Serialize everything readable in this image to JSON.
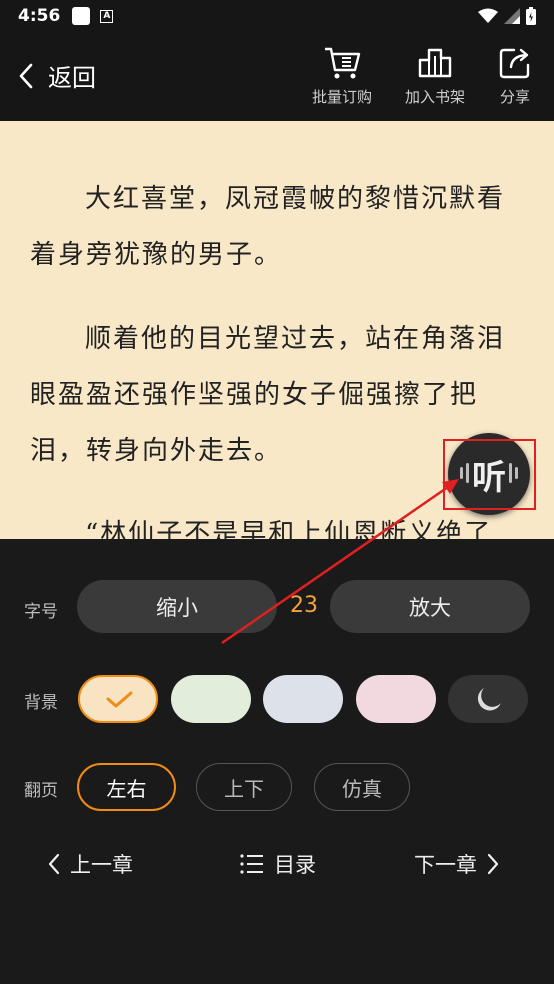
{
  "status": {
    "time": "4:56",
    "a_badge": "A"
  },
  "topbar": {
    "back_label": "返回",
    "batch_label": "批量订购",
    "shelf_label": "加入书架",
    "share_label": "分享"
  },
  "reading": {
    "paragraphs": [
      "大红喜堂，凤冠霞帔的黎惜沉默看着身旁犹豫的男子。",
      "顺着他的目光望过去，站在角落泪眼盈盈还强作坚强的女子倔强擦了把泪，转身向外走去。",
      "“林仙子不是早和上仙恩断义绝了"
    ]
  },
  "listen": {
    "label": "听"
  },
  "panel": {
    "font_label": "字号",
    "shrink_label": "缩小",
    "font_size": "23",
    "enlarge_label": "放大",
    "bg_label": "背景",
    "backgrounds": [
      {
        "name": "cream",
        "color": "#f8e4c2",
        "selected": true
      },
      {
        "name": "green",
        "color": "#e3eddc",
        "selected": false
      },
      {
        "name": "blue",
        "color": "#dde1ea",
        "selected": false
      },
      {
        "name": "pink",
        "color": "#f1d9df",
        "selected": false
      },
      {
        "name": "night",
        "color": "#333333",
        "selected": false
      }
    ],
    "turn_label": "翻页",
    "turn_options": [
      "左右",
      "上下",
      "仿真"
    ],
    "prev_chapter": "上一章",
    "toc": "目录",
    "next_chapter": "下一章"
  },
  "accent": "#f08c14",
  "annotation_color": "#e02020"
}
